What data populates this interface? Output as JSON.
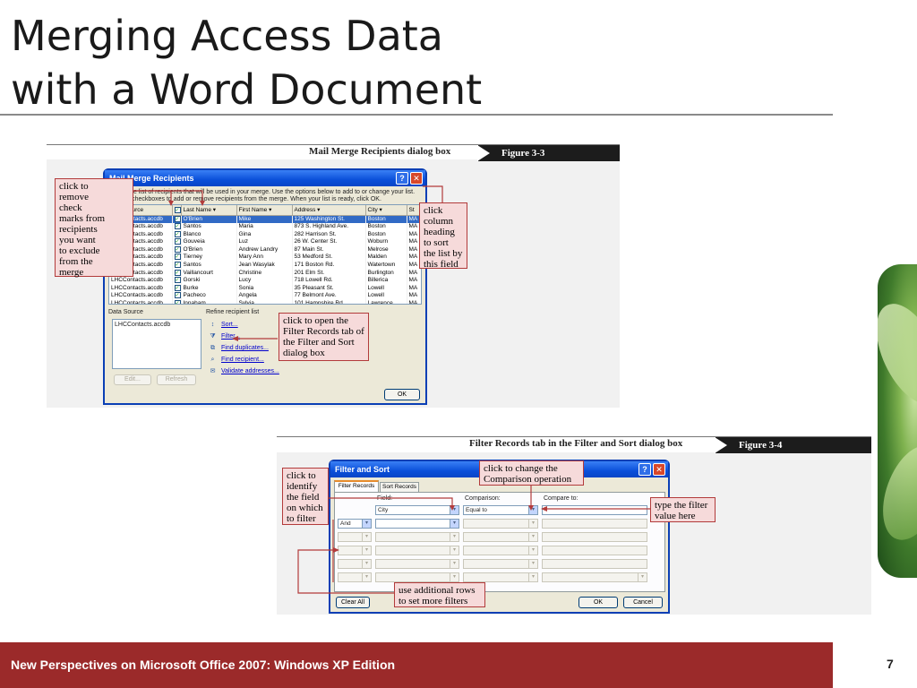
{
  "slide": {
    "title_line1": "Merging Access Data",
    "title_line2": "with a Word Document",
    "footer": "New Perspectives on Microsoft Office 2007: Windows XP Edition",
    "page": "7"
  },
  "figure1": {
    "caption": "Mail Merge Recipients dialog box",
    "label": "Figure  3-3",
    "dialog": {
      "title": "Mail Merge Recipients",
      "instructions": "This is the list of recipients that will be used in your merge.  Use the options below to add to or change your list.  Use the checkboxes to add or remove recipients from the merge.  When your list is ready, click OK.",
      "columns": [
        "Data Source",
        "",
        "Last Name",
        "First Name",
        "Address",
        "City",
        "St"
      ],
      "rows": [
        [
          "LHCContacts.accdb",
          "O'Brien",
          "Mike",
          "125 Washington St.",
          "Boston",
          "MA"
        ],
        [
          "LHCContacts.accdb",
          "Santos",
          "Maria",
          "873 S. Highland Ave.",
          "Boston",
          "MA"
        ],
        [
          "LHCContacts.accdb",
          "Blanco",
          "Gina",
          "282 Harrison St.",
          "Boston",
          "MA"
        ],
        [
          "LHCContacts.accdb",
          "Gouveia",
          "Luz",
          "26 W. Center St.",
          "Woburn",
          "MA"
        ],
        [
          "LHCContacts.accdb",
          "O'Brien",
          "Andrew Landry",
          "87 Main St.",
          "Melrose",
          "MA"
        ],
        [
          "LHCContacts.accdb",
          "Tierney",
          "Mary Ann",
          "53 Medford St.",
          "Malden",
          "MA"
        ],
        [
          "LHCContacts.accdb",
          "Santos",
          "Jean Wasylak",
          "171 Boston Rd.",
          "Watertown",
          "MA"
        ],
        [
          "LHCContacts.accdb",
          "Vaillancourt",
          "Christine",
          "201 Elm St.",
          "Burlington",
          "MA"
        ],
        [
          "LHCContacts.accdb",
          "Gorski",
          "Lucy",
          "718 Lowell Rd.",
          "Billerica",
          "MA"
        ],
        [
          "LHCContacts.accdb",
          "Burke",
          "Sonia",
          "35 Pleasant St.",
          "Lowell",
          "MA"
        ],
        [
          "LHCContacts.accdb",
          "Pacheco",
          "Angela",
          "77 Belmont Ave.",
          "Lowell",
          "MA"
        ],
        [
          "LHCContacts.accdb",
          "Innaham",
          "Sylvia",
          "101 Hampshire Rd.",
          "Lawrence",
          "MA"
        ]
      ],
      "data_source_label": "Data Source",
      "data_source_item": "LHCContacts.accdb",
      "edit_label": "Edit...",
      "refresh_label": "Refresh",
      "refine_label": "Refine recipient list",
      "refine_links": [
        "Sort...",
        "Filter...",
        "Find duplicates...",
        "Find recipient...",
        "Validate addresses..."
      ],
      "ok_label": "OK"
    },
    "callouts": {
      "remove": "click to\nremove\ncheck\nmarks from\nrecipients\nyou want\nto exclude\nfrom the\nmerge",
      "sort": "click\ncolumn\nheading\nto sort\nthe list by\nthis field",
      "filter": "click to open the\nFilter Records tab of\nthe Filter and Sort\ndialog box"
    }
  },
  "figure2": {
    "caption": "Filter Records tab in the Filter and Sort dialog box",
    "label": "Figure  3-4",
    "dialog": {
      "title": "Filter and Sort",
      "tabs": [
        "Filter Records",
        "Sort Records"
      ],
      "field_header": "Field:",
      "comparison_header": "Comparison:",
      "compare_to_header": "Compare to:",
      "first_row": {
        "field": "City",
        "comparison": "Equal to",
        "value": ""
      },
      "second_row_connector": "And",
      "clear_all": "Clear All",
      "ok_label": "OK",
      "cancel_label": "Cancel"
    },
    "callouts": {
      "identify": "click to\nidentify\nthe field\non which\nto filter",
      "comparison": "click to change the\nComparison operation",
      "value": "type the filter\nvalue here",
      "rows": "use additional rows\nto set more filters"
    }
  },
  "colors": {
    "footer_bg": "#9b2a2a",
    "callout_border": "#b23b3b",
    "callout_bg": "#f6dada",
    "xp_title": "#0a4fd9"
  }
}
